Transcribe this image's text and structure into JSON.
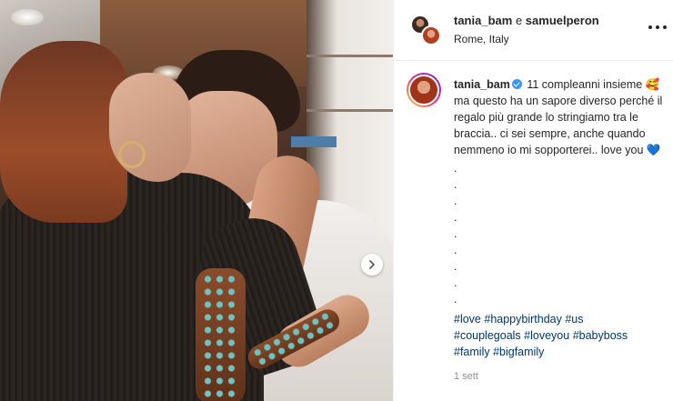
{
  "post": {
    "header": {
      "user1": "tania_bam",
      "conjunction": "e",
      "user2": "samuelperon",
      "location": "Rome, Italy"
    },
    "caption": {
      "username": "tania_bam",
      "line1": "11 compleanni insieme",
      "emoji1": "🥰",
      "body": "ma questo ha un sapore diverso perché il regalo più grande lo stringiamo tra le braccia.. ci sei sempre, anche quando nemmeno io mi sopporterei.. love you",
      "heart": "💙",
      "dots": [
        ".",
        ".",
        ".",
        ".",
        ".",
        ".",
        ".",
        ".",
        "."
      ],
      "hashtags": [
        "#love",
        "#happybirthday",
        "#us",
        "#couplegoals",
        "#loveyou",
        "#babyboss",
        "#family",
        "#bigfamily"
      ]
    },
    "timestamp": "1 sett"
  },
  "icons": {
    "next": "chevron-right-icon",
    "more": "more-horizontal-icon",
    "verified": "verified-badge-icon"
  },
  "colors": {
    "link": "#00376b",
    "verified": "#3897f0",
    "muted": "#8e8e8e"
  }
}
